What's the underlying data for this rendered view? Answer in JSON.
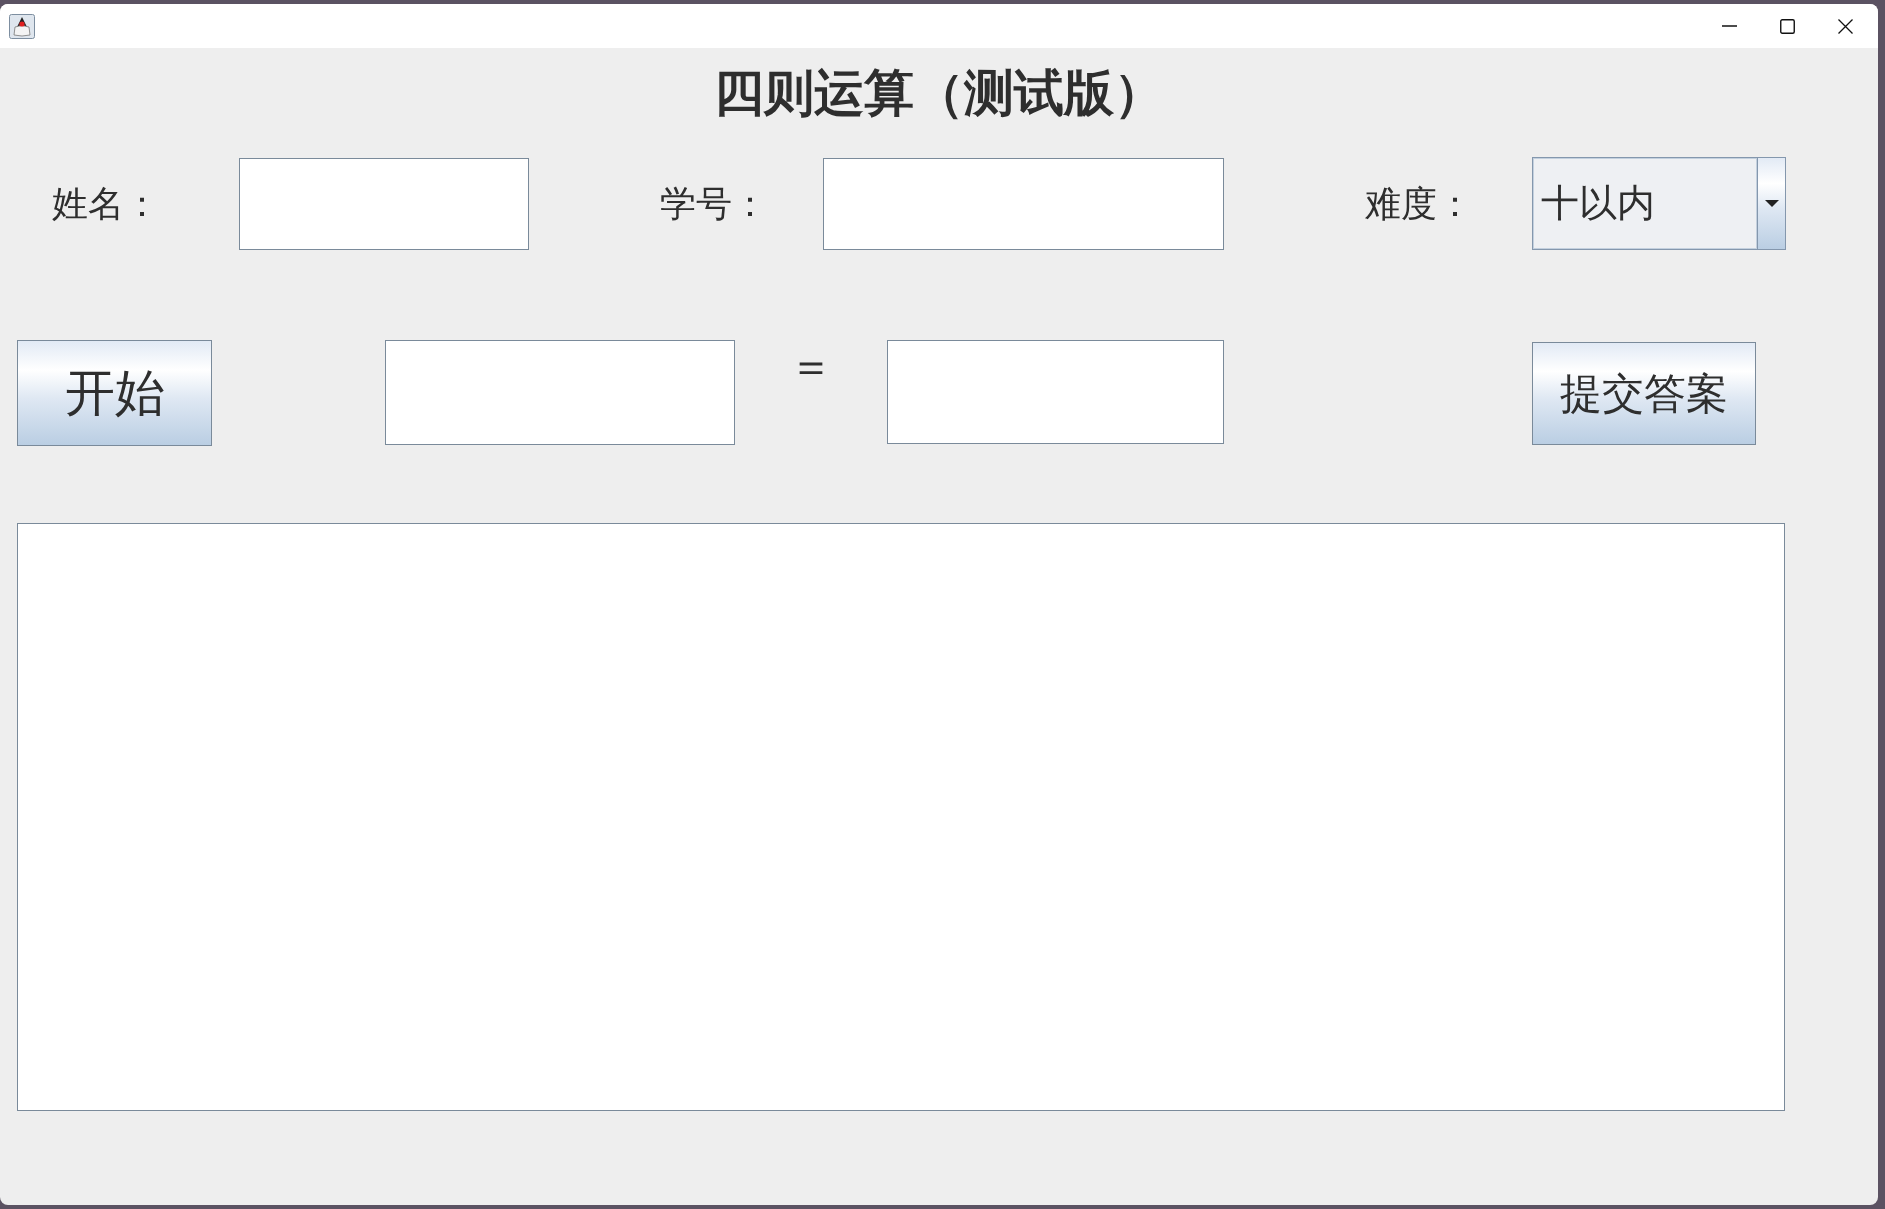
{
  "heading": "四则运算（测试版）",
  "student_fields": [
    {
      "label": "姓名："
    },
    {
      "label": "学号："
    }
  ],
  "difficulty": {
    "label": "难度：",
    "value": "十以内"
  },
  "start_button": {
    "label": "开始"
  },
  "equals_sign": "＝",
  "submit_button": {
    "label": "提交答案"
  }
}
